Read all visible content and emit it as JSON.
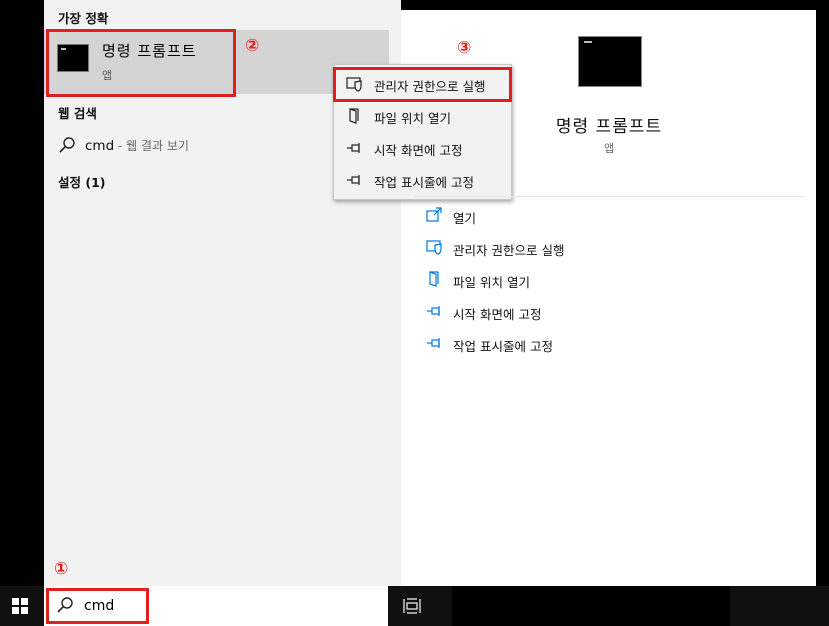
{
  "results": {
    "best_match_header": "가장 정확",
    "best_match": {
      "title": "명령 프롬프트",
      "subtitle": "앱"
    },
    "web_header": "웹 검색",
    "web_item": {
      "query": "cmd",
      "suffix": " - 웹 결과 보기"
    },
    "settings_header": "설정 (1)"
  },
  "context_menu": {
    "items": [
      {
        "label": "관리자 권한으로 실행",
        "icon": "shield-icon"
      },
      {
        "label": "파일 위치 열기",
        "icon": "file-location-icon"
      },
      {
        "label": "시작 화면에 고정",
        "icon": "pin-icon"
      },
      {
        "label": "작업 표시줄에 고정",
        "icon": "pin-icon"
      }
    ]
  },
  "detail": {
    "title": "명령 프롬프트",
    "subtitle": "앱",
    "actions": [
      {
        "label": "열기",
        "icon": "open-icon"
      },
      {
        "label": "관리자 권한으로 실행",
        "icon": "shield-icon"
      },
      {
        "label": "파일 위치 열기",
        "icon": "file-location-icon"
      },
      {
        "label": "시작 화면에 고정",
        "icon": "pin-icon"
      },
      {
        "label": "작업 표시줄에 고정",
        "icon": "pin-icon"
      }
    ]
  },
  "annotations": {
    "step1": "①",
    "step2": "②",
    "step3": "③"
  },
  "taskbar": {
    "search_value": "cmd"
  },
  "colors": {
    "accent": "#0078d7",
    "highlight": "#e0201f",
    "panel": "#f2f2f2",
    "selected": "#d4d4d4"
  }
}
